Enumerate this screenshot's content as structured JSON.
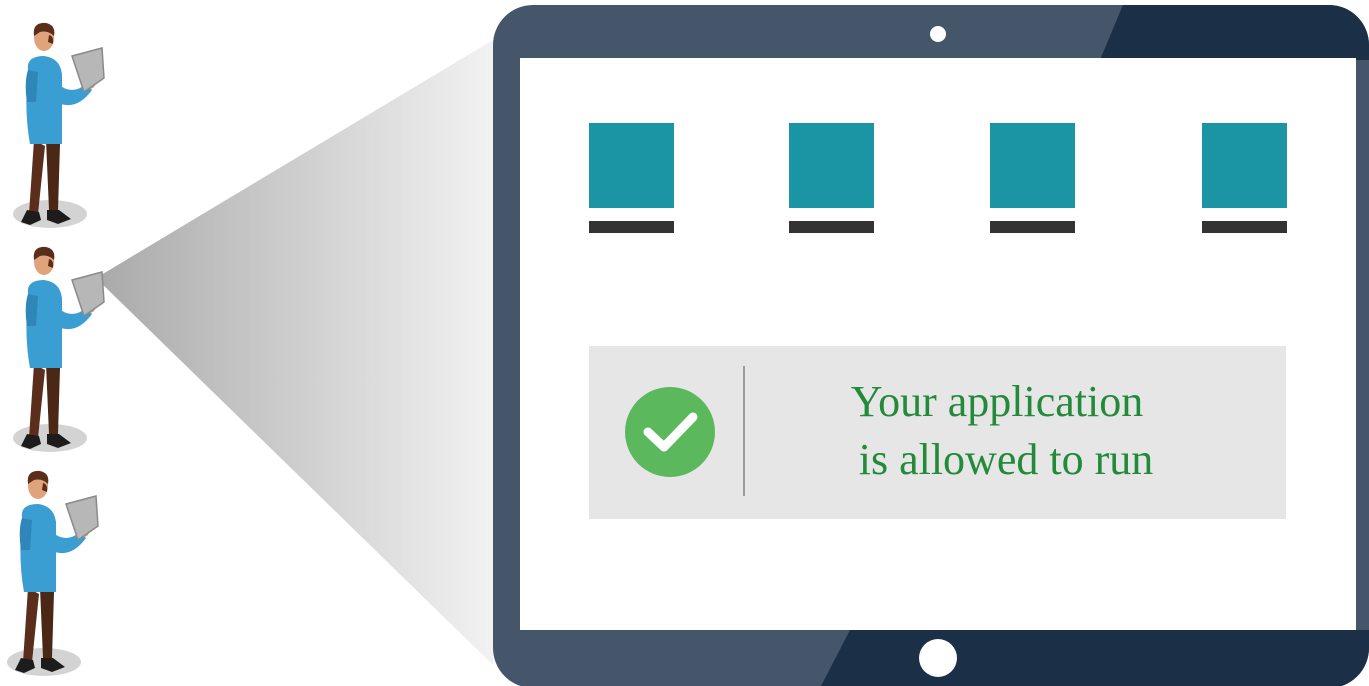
{
  "status_banner": {
    "line1": "Your application",
    "line2": "is allowed to run",
    "icon": "check-circle-icon",
    "text_color": "#238a3a"
  },
  "app_tiles": [
    {
      "icon": "app-tile-icon"
    },
    {
      "icon": "app-tile-icon"
    },
    {
      "icon": "app-tile-icon"
    },
    {
      "icon": "app-tile-icon"
    }
  ],
  "people": [
    {
      "icon": "person-holding-tablet-icon"
    },
    {
      "icon": "person-holding-tablet-icon"
    },
    {
      "icon": "person-holding-tablet-icon"
    }
  ],
  "colors": {
    "tablet_frame": "#45566a",
    "tablet_frame_dark": "#1b2f47",
    "screen": "#ffffff",
    "tile": "#1b95a4",
    "tile_underline": "#333333",
    "banner_bg": "#e6e6e6",
    "check_green": "#5cb85c",
    "shirt": "#3a9ed3",
    "pants": "#5a2e1b"
  }
}
